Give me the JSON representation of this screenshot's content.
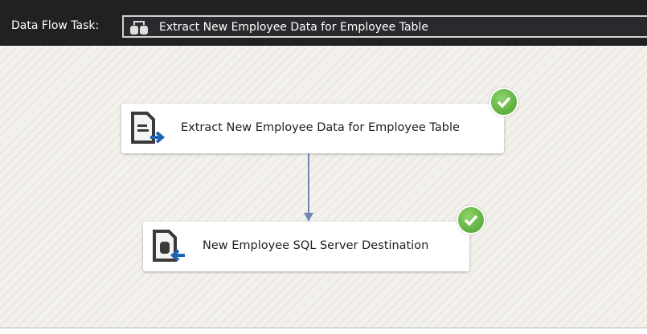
{
  "toolbar": {
    "label": "Data Flow Task:",
    "selected_task": "Extract New Employee Data for Employee Table"
  },
  "nodes": [
    {
      "label": "Extract New Employee Data for Employee Table",
      "icon": "source-file-icon",
      "status": "success"
    },
    {
      "label": "New Employee SQL Server Destination",
      "icon": "sql-destination-icon",
      "status": "success"
    }
  ],
  "colors": {
    "accent": "#1e64b4",
    "connector": "#6f89b0",
    "success": "#5cb23a"
  }
}
